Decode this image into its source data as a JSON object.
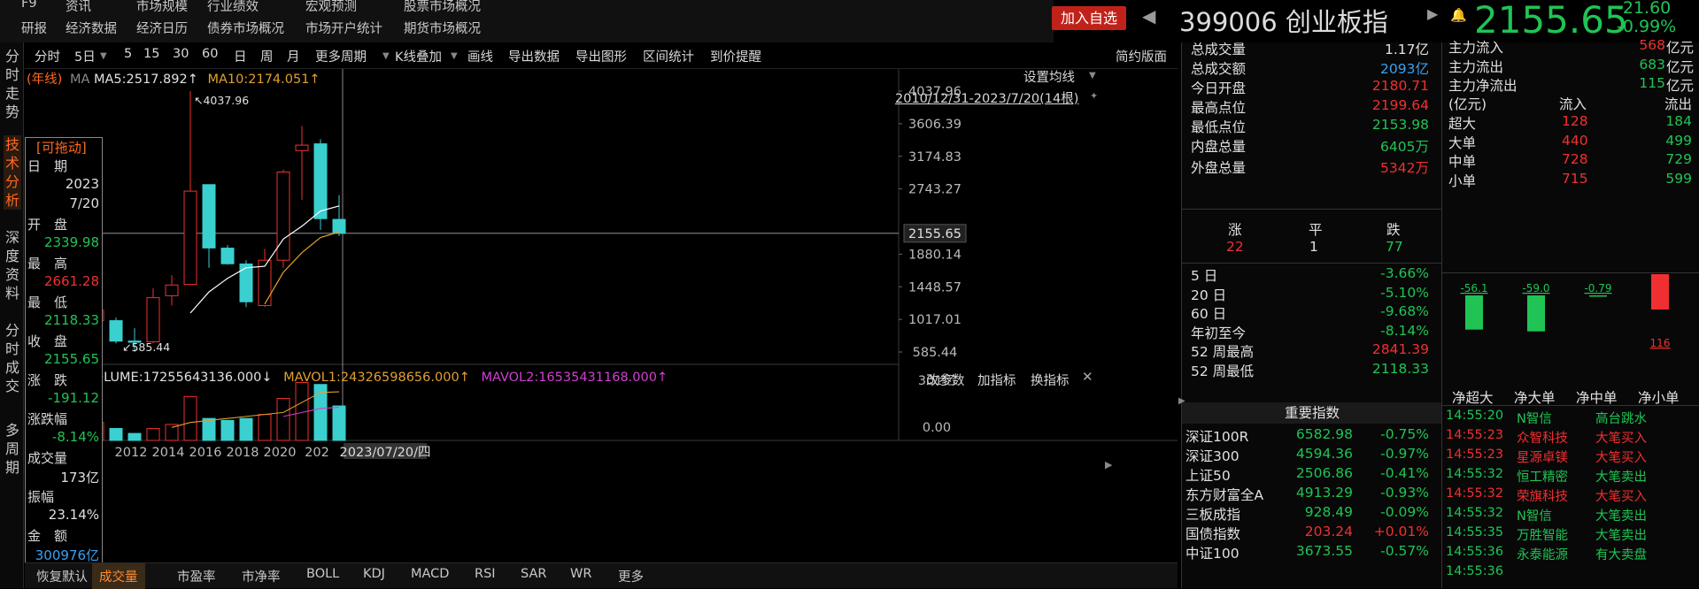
{
  "topnav": {
    "row1": [
      "F9",
      "资讯",
      "市场规模",
      "行业绩效",
      "宏观预测",
      "股票市场概况"
    ],
    "row2": [
      "研报",
      "经济数据",
      "经济日历",
      "债券市场概况",
      "市场开户统计",
      "期货市场概况"
    ]
  },
  "header": {
    "add_button": "加入自选",
    "code_name": "399006 创业板指",
    "price": "2155.65",
    "change": "-21.60",
    "change_pct": "-0.99%"
  },
  "leftnav": [
    [
      "分",
      "时",
      "走",
      "势"
    ],
    [
      "技",
      "术",
      "分",
      "析"
    ],
    [
      "深",
      "度",
      "资",
      "料"
    ],
    [
      "分",
      "时",
      "成",
      "交"
    ],
    [
      "多",
      "周",
      "期"
    ]
  ],
  "toolbar": {
    "items": [
      "分时",
      "5日",
      "5",
      "15",
      "30",
      "60",
      "日",
      "周",
      "月",
      "更多周期",
      "K线叠加",
      "画线",
      "导出数据",
      "导出图形",
      "区间统计",
      "到价提醒"
    ],
    "right": "简约版面"
  },
  "chart": {
    "ma_line": {
      "period": "(年线)",
      "ma": "MA",
      "ma5": "MA5:2517.892↑",
      "ma10": "MA10:2174.051↑"
    },
    "setting": "设置均线",
    "range": "2010/12/31-2023/7/20(14根)",
    "y_labels": [
      "4037.96",
      "3606.39",
      "3174.83",
      "2743.27",
      "1880.14",
      "1448.57",
      "1017.01",
      "585.44"
    ],
    "cur_price": "2155.65",
    "high_mark": "4037.96",
    "low_mark": "585.44",
    "x_labels": [
      "2012",
      "2014",
      "2016",
      "2018",
      "2020",
      "202"
    ],
    "x_current": "2023/07/20/四",
    "vol_line": {
      "vol": "VOLUME:17255643136.000↓",
      "mavol1": "MAVOL1:24326598656.000↑",
      "mavol2": "MAVOL2:16535431168.000↑"
    },
    "vol_btns": [
      "改参数",
      "加指标",
      "换指标"
    ],
    "vol_y": [
      "301亿",
      "0.00"
    ]
  },
  "chart_data": {
    "type": "candlestick",
    "period": "年线",
    "x": [
      "2010",
      "2011",
      "2012",
      "2013",
      "2014",
      "2015",
      "2016",
      "2017",
      "2018",
      "2019",
      "2020",
      "2021",
      "2022",
      "2023"
    ],
    "open": [
      1000,
      1000,
      730,
      720,
      1330,
      1480,
      2800,
      1960,
      1750,
      1200,
      1800,
      3250,
      3340,
      2340
    ],
    "high": [
      1240,
      1040,
      900,
      1430,
      1600,
      4037.96,
      2800,
      2000,
      1800,
      1950,
      3000,
      3576,
      3400,
      2661.28
    ],
    "low": [
      950,
      700,
      585.44,
      700,
      1200,
      1480,
      1700,
      1740,
      1180,
      1180,
      1700,
      2600,
      2200,
      2118.33
    ],
    "close": [
      1137,
      729,
      714,
      1304,
      1472,
      2714,
      1962,
      1753,
      1250,
      1800,
      2967,
      3323,
      2350,
      2155.65
    ],
    "ma5": [
      null,
      null,
      null,
      null,
      null,
      null,
      null,
      null,
      null,
      null,
      1900,
      2250,
      2450,
      2517.892
    ],
    "ma10": [
      null,
      null,
      null,
      null,
      null,
      null,
      null,
      null,
      null,
      null,
      null,
      null,
      2100,
      2174.051
    ],
    "ylim": [
      585.44,
      4037.96
    ]
  },
  "infobox": {
    "drag": "[可拖动]",
    "rows": [
      [
        "日　期",
        ""
      ],
      [
        "",
        "2023"
      ],
      [
        "",
        "7/20"
      ],
      [
        "开　盘",
        ""
      ],
      [
        "",
        "2339.98"
      ],
      [
        "最　高",
        ""
      ],
      [
        "",
        "2661.28"
      ],
      [
        "最　低",
        ""
      ],
      [
        "",
        "2118.33"
      ],
      [
        "收　盘",
        ""
      ],
      [
        "",
        "2155.65"
      ],
      [
        "涨　跌",
        ""
      ],
      [
        "",
        "-191.12"
      ],
      [
        "涨跌幅",
        ""
      ],
      [
        "",
        "-8.14%"
      ],
      [
        "成交量",
        ""
      ],
      [
        "",
        "173亿"
      ],
      [
        "振幅",
        ""
      ],
      [
        "",
        "23.14%"
      ],
      [
        "金　额",
        ""
      ],
      [
        "",
        "300976亿"
      ]
    ]
  },
  "bottomtabs": [
    "恢复默认",
    "成交量",
    "市盈率",
    "市净率",
    "BOLL",
    "KDJ",
    "MACD",
    "RSI",
    "SAR",
    "WR",
    "更多"
  ],
  "stats": [
    [
      "总成交量",
      "1.17亿"
    ],
    [
      "总成交额",
      "2093亿"
    ],
    [
      "今日开盘",
      "2180.71"
    ],
    [
      "最高点位",
      "2199.64"
    ],
    [
      "最低点位",
      "2153.98"
    ],
    [
      "内盘总量",
      "6405万"
    ],
    [
      "外盘总量",
      "5342万"
    ]
  ],
  "updown": {
    "labels": [
      "涨",
      "平",
      "跌"
    ],
    "values": [
      "22",
      "1",
      "77"
    ]
  },
  "perf": [
    [
      "5 日",
      "-3.66%"
    ],
    [
      "20 日",
      "-5.10%"
    ],
    [
      "60 日",
      "-9.68%"
    ],
    [
      "年初至今",
      "-8.14%"
    ],
    [
      "52 周最高",
      "2841.39"
    ],
    [
      "52 周最低",
      "2118.33"
    ]
  ],
  "indices_title": "重要指数",
  "indices": [
    [
      "深证100R",
      "6582.98",
      "-0.75%"
    ],
    [
      "深证300",
      "4594.36",
      "-0.97%"
    ],
    [
      "上证50",
      "2506.86",
      "-0.41%"
    ],
    [
      "东方财富全A",
      "4913.29",
      "-0.93%"
    ],
    [
      "三板成指",
      "928.49",
      "-0.09%"
    ],
    [
      "国债指数",
      "203.24",
      "+0.01%"
    ],
    [
      "中证100",
      "3673.55",
      "-0.57%"
    ]
  ],
  "fund": {
    "top": [
      [
        "主力流入",
        "568",
        "亿元"
      ],
      [
        "主力流出",
        "683",
        "亿元"
      ],
      [
        "主力净流出",
        "115",
        "亿元"
      ]
    ],
    "head": [
      "(亿元)",
      "流入",
      "流出"
    ],
    "rows": [
      [
        "超大",
        "128",
        "184"
      ],
      [
        "大单",
        "440",
        "499"
      ],
      [
        "中单",
        "728",
        "729"
      ],
      [
        "小单",
        "715",
        "599"
      ]
    ],
    "bars": [
      {
        "label": "-56.1",
        "value": -56.1
      },
      {
        "label": "-59.0",
        "value": -59.0
      },
      {
        "label": "-0.79",
        "value": -0.79
      },
      {
        "label": "116",
        "value": 116
      }
    ],
    "bar_titles": [
      "净超大",
      "净大单",
      "净中单",
      "净小单"
    ]
  },
  "trades": [
    [
      "14:55:20",
      "N智信",
      "高台跳水"
    ],
    [
      "14:55:23",
      "众智科技",
      "大笔买入"
    ],
    [
      "14:55:23",
      "星源卓镁",
      "大笔买入"
    ],
    [
      "14:55:32",
      "恒工精密",
      "大笔卖出"
    ],
    [
      "14:55:32",
      "荣旗科技",
      "大笔买入"
    ],
    [
      "14:55:32",
      "N智信",
      "大笔卖出"
    ],
    [
      "14:55:35",
      "万胜智能",
      "大笔卖出"
    ],
    [
      "14:55:36",
      "永泰能源",
      "有大卖盘"
    ],
    [
      "14:55:36",
      "",
      ""
    ]
  ],
  "colors": {
    "up": "#f03030",
    "down": "#20c454",
    "candle_down": "#3ad0d0",
    "ma5": "#ffffff",
    "ma10": "#e0a030",
    "mavol2": "#d040d0"
  }
}
